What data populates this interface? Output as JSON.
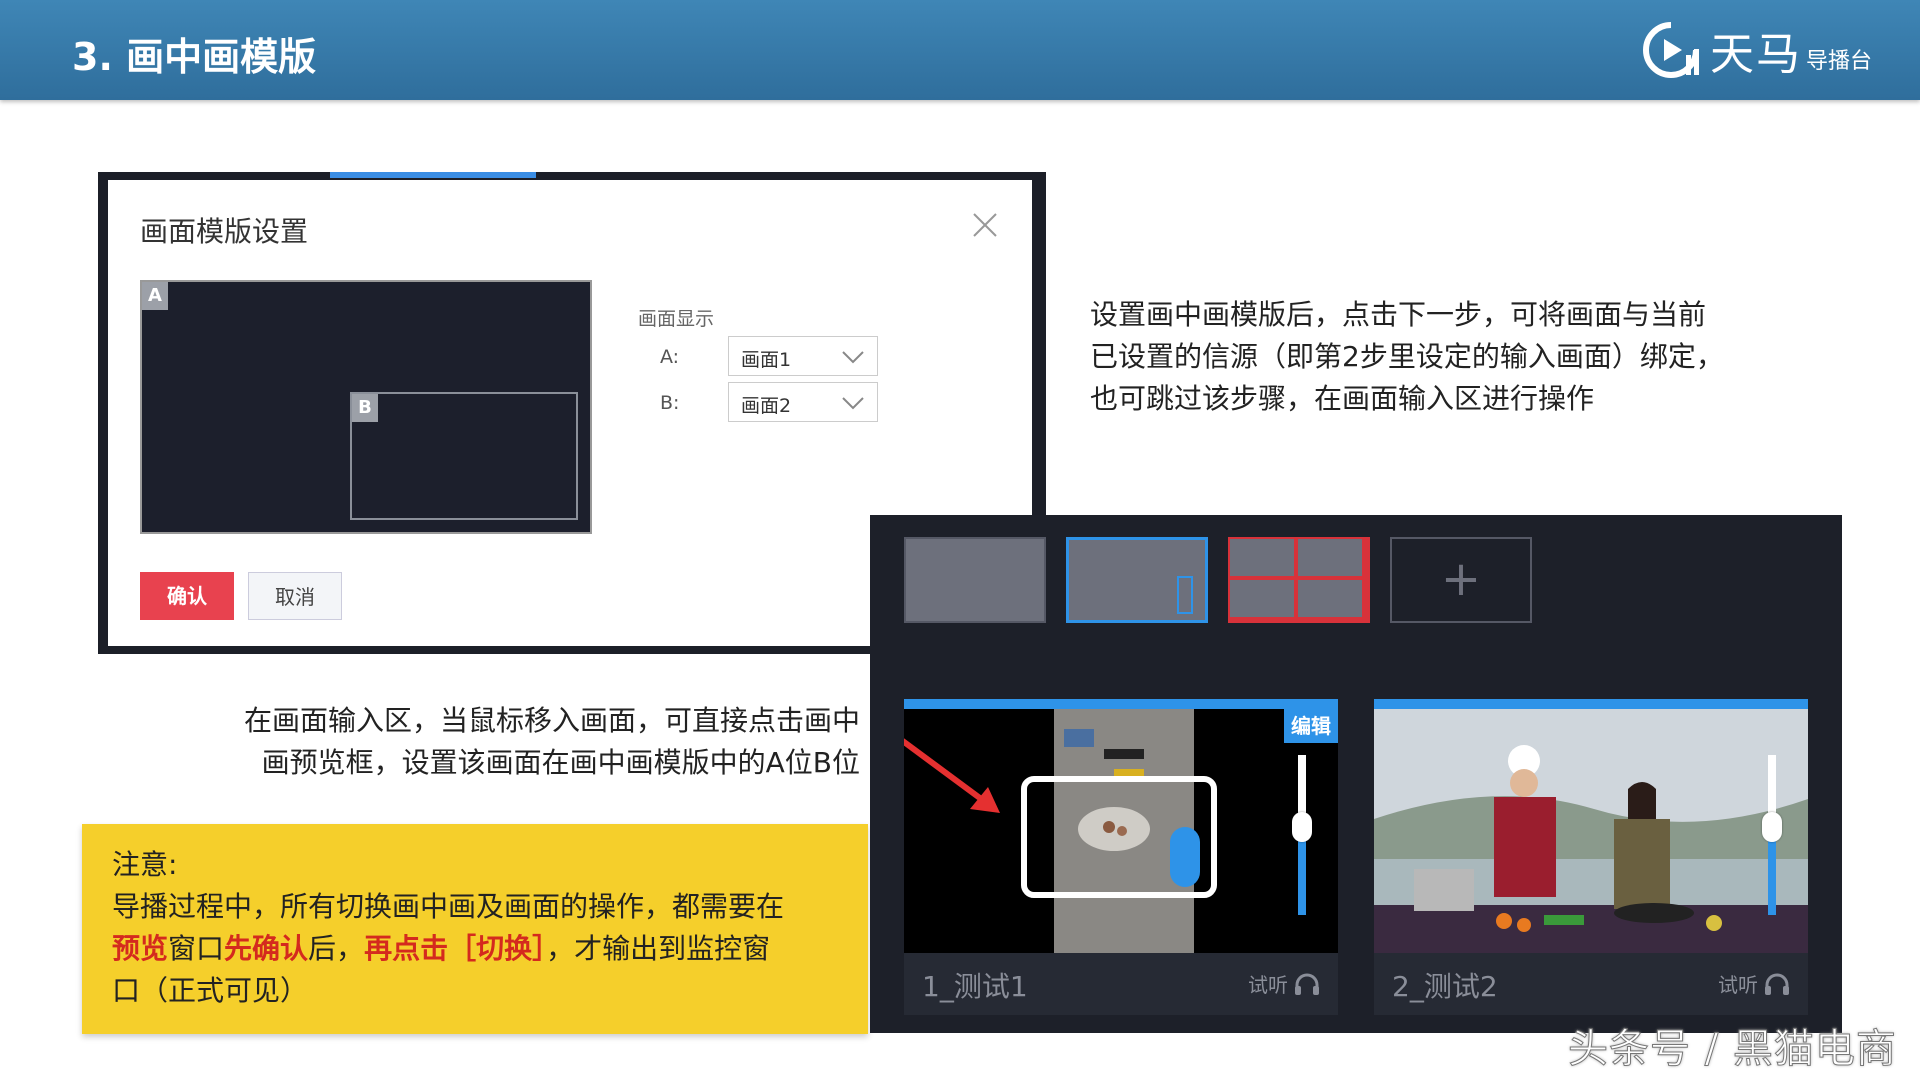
{
  "header": {
    "title": "3. 画中画模版",
    "logo_text": "天马",
    "logo_sub": "导播台"
  },
  "dialog": {
    "title": "画面模版设置",
    "badge_a": "A",
    "badge_b": "B",
    "display_label": "画面显示",
    "row_a_label": "A:",
    "row_b_label": "B:",
    "select_a_value": "画面1",
    "select_b_value": "画面2",
    "confirm_label": "确认",
    "cancel_label": "取消"
  },
  "desc_right": {
    "line1": "设置画中画模版后，点击下一步，可将画面与当前",
    "line2": "已设置的信源（即第2步里设定的输入画面）绑定，",
    "line3": "也可跳过该步骤，在画面输入区进行操作"
  },
  "desc_left": {
    "line1": "在画面输入区，当鼠标移入画面，可直接点击画中",
    "line2": "画预览框，设置该画面在画中画模版中的A位B位"
  },
  "note": {
    "title": "注意:",
    "line1": "导播过程中，所有切换画中画及画面的操作，都需要在",
    "seg_preview": "预览",
    "seg_window": "窗口",
    "seg_confirm_first": "先确认",
    "seg_after": "后，",
    "seg_click_switch": "再点击［切换］",
    "seg_output": "，才输出到监控窗",
    "line3": "口（正式可见）"
  },
  "editor": {
    "add_label": "+",
    "cam1": {
      "label": "1_测试1",
      "listen": "试听",
      "edit": "编辑",
      "volume_fraction": 0.55
    },
    "cam2": {
      "label": "2_测试2",
      "listen": "试听",
      "volume_fraction": 0.55
    },
    "accent_color": "#2e93e8"
  },
  "watermark": "头条号 / 黑猫电商"
}
